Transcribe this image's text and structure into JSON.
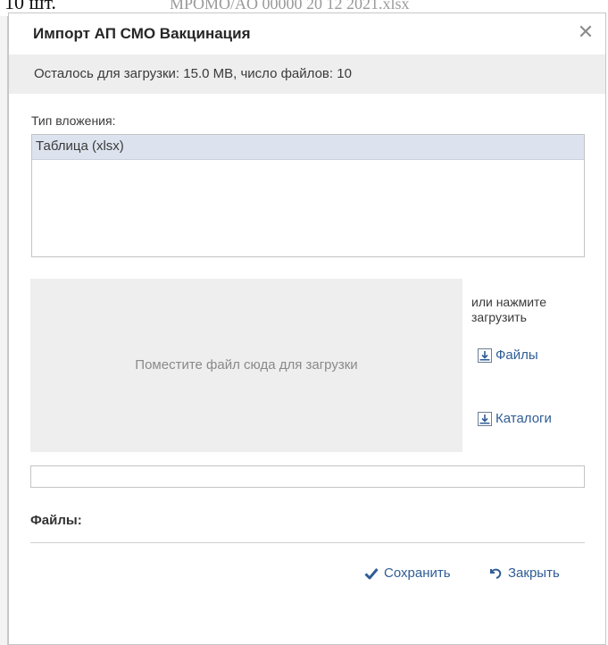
{
  "background": {
    "cut_text": "10 шт.",
    "line_text": "MPOMO/AO 00000 20 12 2021.xlsx"
  },
  "dialog": {
    "title": "Импорт АП СМО Вакцинация",
    "close_glyph": "✕",
    "remaining_info": "Осталось для загрузки: 15.0 MB, число файлов: 10"
  },
  "attachment": {
    "label": "Тип вложения:",
    "items": [
      {
        "label": "Таблица (xlsx)",
        "selected": true
      }
    ]
  },
  "dropzone": {
    "text": "Поместите файл сюда для загрузки"
  },
  "upload": {
    "or_text": "или нажмите загрузить",
    "files_label": "Файлы",
    "dirs_label": "Каталоги",
    "icon": "download-icon"
  },
  "progress": {
    "value": 0
  },
  "files_section": {
    "label": "Файлы:"
  },
  "footer": {
    "save_label": "Сохранить",
    "close_label": "Закрыть",
    "save_icon": "checkmark-icon",
    "close_icon": "undo-icon"
  },
  "colors": {
    "accent": "#2f5d95",
    "selected_row": "#dde3ee",
    "info_bar": "#eeeeee"
  }
}
